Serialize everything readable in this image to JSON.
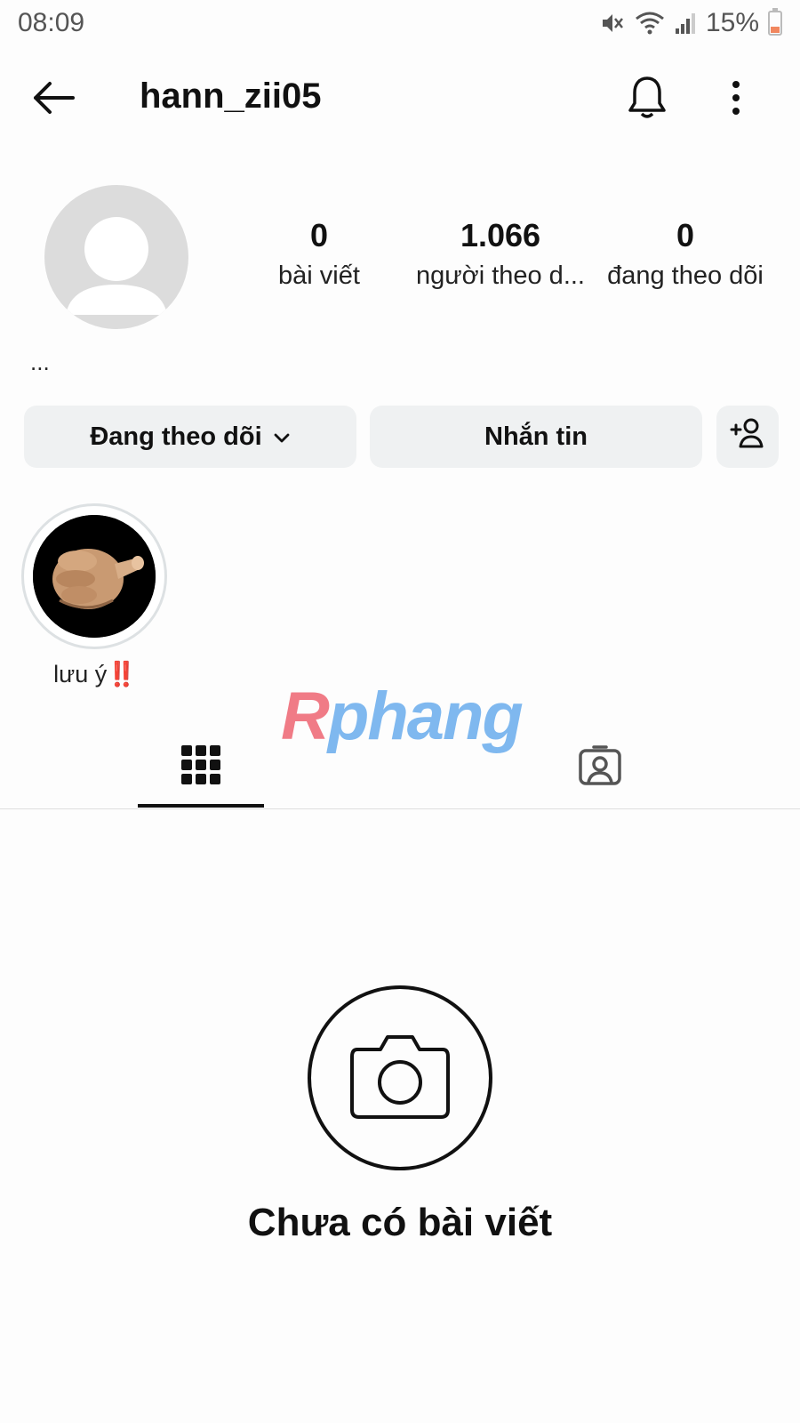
{
  "status_bar": {
    "time": "08:09",
    "battery": "15%"
  },
  "header": {
    "username": "hann_zii05"
  },
  "profile": {
    "posts_count": "0",
    "posts_label": "bài viết",
    "followers_count": "1.066",
    "followers_label": "người theo d...",
    "following_count": "0",
    "following_label": "đang theo dõi",
    "bio": "..."
  },
  "actions": {
    "following_label": "Đang theo dõi",
    "message_label": "Nhắn tin"
  },
  "highlights": [
    {
      "label": "lưu ý",
      "emoji": "‼️"
    }
  ],
  "watermark": {
    "first_letter": "R",
    "rest": "phang"
  },
  "tabs": {
    "active": "grid",
    "items": [
      "grid",
      "tagged"
    ]
  },
  "empty_state": {
    "text": "Chưa có bài viết"
  },
  "colors": {
    "background": "#fdfdfd",
    "button_bg": "#eff1f2",
    "text": "#111111",
    "avatar_placeholder": "#dcdcdc"
  },
  "icons": [
    "back-arrow-icon",
    "bell-icon",
    "more-vert-icon",
    "chevron-down-icon",
    "add-person-icon",
    "grid-icon",
    "tagged-icon",
    "camera-icon",
    "wifi-icon",
    "signal-icon",
    "mute-icon",
    "battery-icon"
  ]
}
